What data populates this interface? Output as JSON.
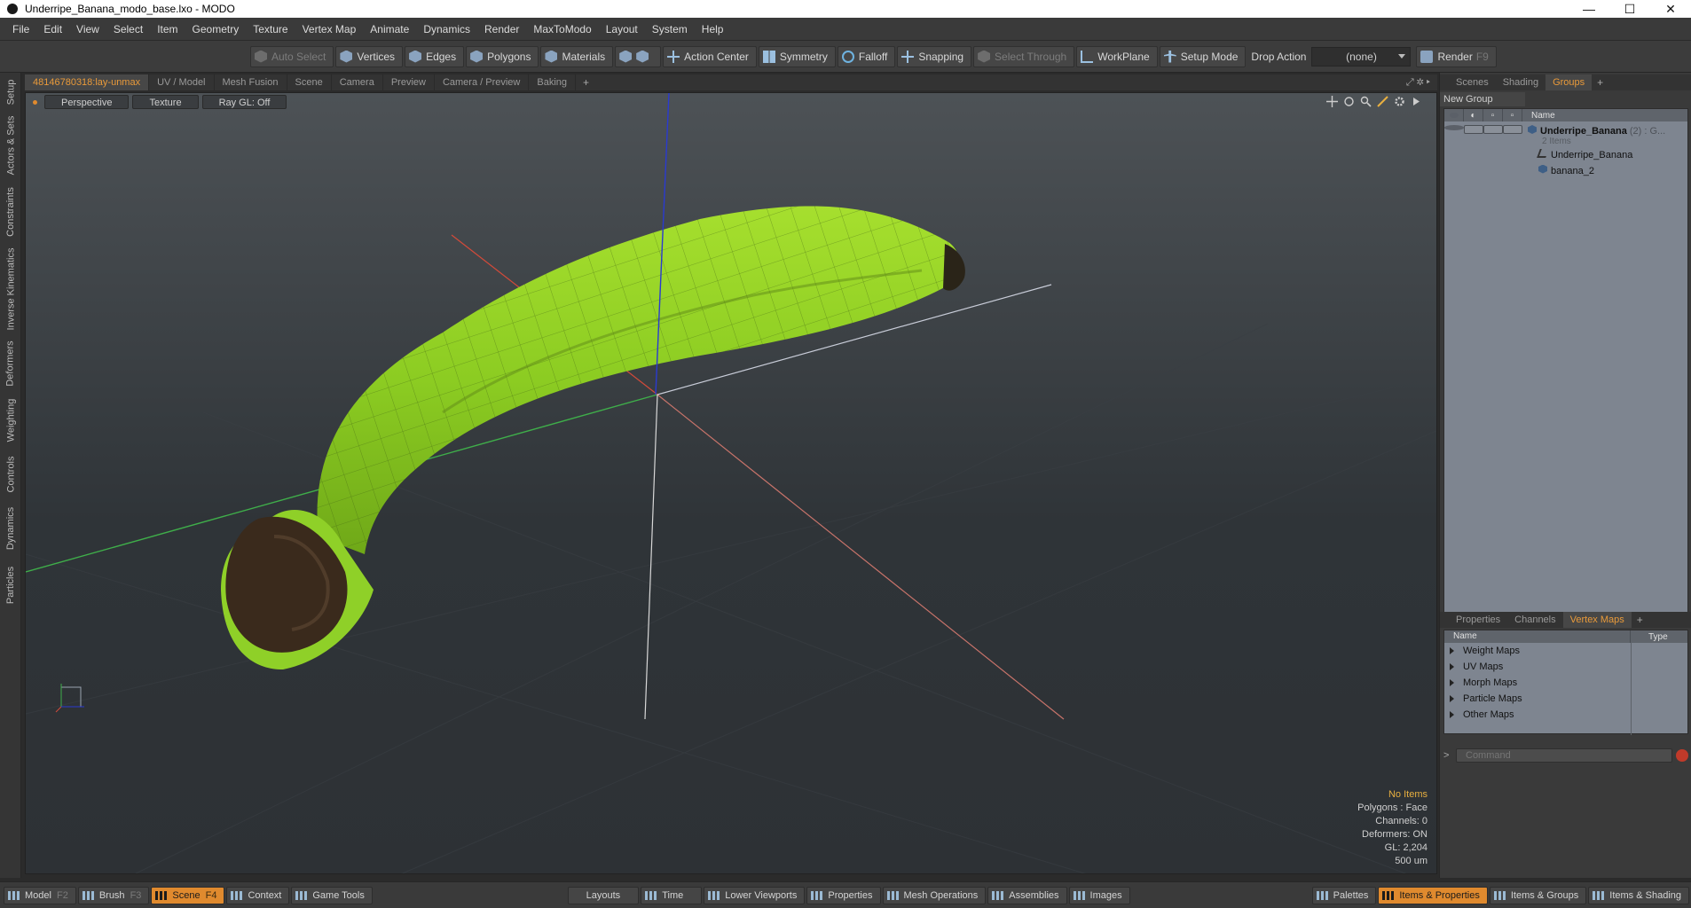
{
  "window": {
    "title": "Underripe_Banana_modo_base.lxo - MODO",
    "controls": [
      "—",
      "☐",
      "✕"
    ]
  },
  "menu": [
    "File",
    "Edit",
    "View",
    "Select",
    "Item",
    "Geometry",
    "Texture",
    "Vertex Map",
    "Animate",
    "Dynamics",
    "Render",
    "MaxToModo",
    "Layout",
    "System",
    "Help"
  ],
  "toolbar": {
    "auto_select": "Auto Select",
    "vertices": "Vertices",
    "edges": "Edges",
    "polygons": "Polygons",
    "materials": "Materials",
    "action_center": "Action Center",
    "symmetry": "Symmetry",
    "falloff": "Falloff",
    "snapping": "Snapping",
    "select_through": "Select Through",
    "workplane": "WorkPlane",
    "setup_mode": "Setup Mode",
    "drop_action_label": "Drop Action",
    "drop_action_value": "(none)",
    "render": "Render",
    "render_key": "F9"
  },
  "left_tabs": [
    "Setup",
    "Actors & Sets",
    "Constraints",
    "Inverse Kinematics",
    "Deformers",
    "Weighting",
    "Controls",
    "Dynamics",
    "Particles"
  ],
  "viewport_tabs": [
    "48146780318:lay-unmax",
    "UV / Model",
    "Mesh Fusion",
    "Scene",
    "Camera",
    "Preview",
    "Camera / Preview",
    "Baking"
  ],
  "viewport": {
    "view_mode": "Perspective",
    "shading": "Texture",
    "raygl": "Ray GL: Off",
    "info": {
      "no_items": "No Items",
      "polygons": "Polygons : Face",
      "channels": "Channels: 0",
      "deformers": "Deformers: ON",
      "gl": "GL: 2,204",
      "scale": "500 um"
    }
  },
  "right_panel": {
    "top_tabs": [
      "Scenes",
      "Shading",
      "Groups"
    ],
    "new_group": "New Group",
    "tree_header_name": "Name",
    "group": {
      "name": "Underripe_Banana",
      "count_suffix": "(2) : G...",
      "sub": "2 Items"
    },
    "children": [
      "Underripe_Banana",
      "banana_2"
    ],
    "bottom_tabs": [
      "Properties",
      "Channels",
      "Vertex Maps"
    ],
    "vm_header_name": "Name",
    "vm_header_type": "Type",
    "vertex_maps": [
      "Weight Maps",
      "UV Maps",
      "Morph Maps",
      "Particle Maps",
      "Other Maps"
    ],
    "command_placeholder": "Command"
  },
  "bottom_bar": {
    "model": "Model",
    "model_key": "F2",
    "brush": "Brush",
    "brush_key": "F3",
    "scene": "Scene",
    "scene_key": "F4",
    "context": "Context",
    "game_tools": "Game Tools",
    "layouts": "Layouts",
    "time": "Time",
    "lower_viewports": "Lower Viewports",
    "properties": "Properties",
    "mesh_operations": "Mesh Operations",
    "assemblies": "Assemblies",
    "images": "Images",
    "palettes": "Palettes",
    "items_properties": "Items & Properties",
    "items_groups": "Items & Groups",
    "items_shading": "Items & Shading"
  },
  "colors": {
    "accent": "#e08a2e",
    "banana": "#9bd62a",
    "axis_x": "#d24a3a",
    "axis_y": "#3a9a3a",
    "axis_z": "#2a3ab8"
  }
}
